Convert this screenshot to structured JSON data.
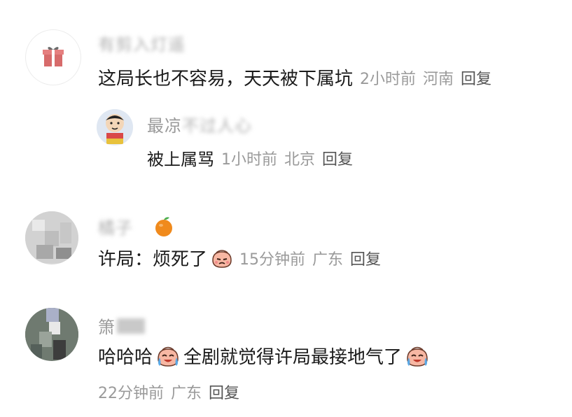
{
  "comments": [
    {
      "name": "有剪入灯遥",
      "avatar_icon": "gift-icon",
      "content": "这局长也不容易，天天被下属坑",
      "time": "2小时前",
      "location": "河南",
      "reply": "回复",
      "replies": [
        {
          "name_clear": "最凉",
          "name_blurred": "不过人心",
          "avatar_icon": "cartoon-boy-icon",
          "content": "被上属骂",
          "time": "1小时前",
          "location": "北京",
          "reply": "回复"
        }
      ]
    },
    {
      "name": "橘子",
      "badge_icon": "orange-icon",
      "avatar_icon": "blurred-avatar",
      "content": "许局：烦死了",
      "emoji": "annoyed-face-emoji",
      "time": "15分钟前",
      "location": "广东",
      "reply": "回复"
    },
    {
      "name": "箫",
      "avatar_icon": "blurred-avatar",
      "content_a": "哈哈哈",
      "content_b": "全剧就觉得许局最接地气了",
      "emoji": "laugh-cry-emoji",
      "time": "22分钟前",
      "location": "广东",
      "reply": "回复"
    }
  ],
  "colors": {
    "meta": "#9a9a9a",
    "text": "#1a1a1a",
    "orange": "#f08a1c"
  }
}
